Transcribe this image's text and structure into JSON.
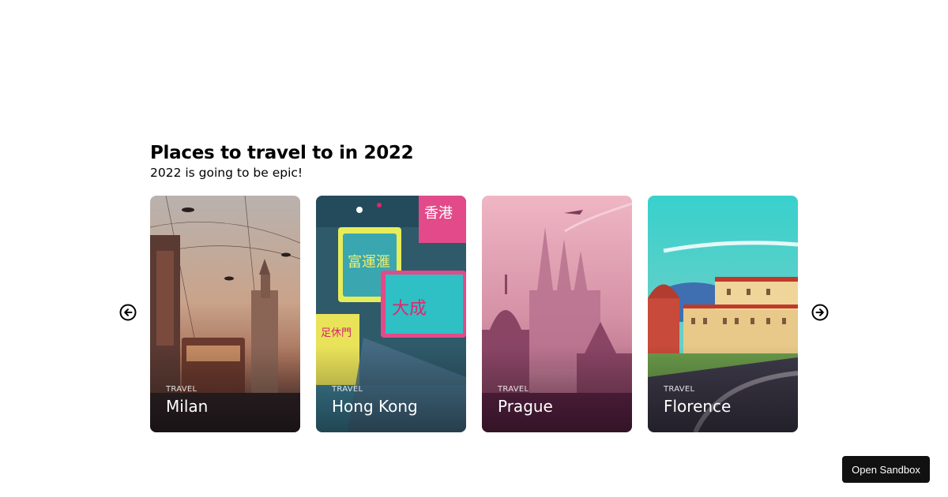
{
  "header": {
    "title": "Places to travel to in 2022",
    "subtitle": "2022 is going to be epic!"
  },
  "carousel": {
    "cards": [
      {
        "tag": "TRAVEL",
        "name": "Milan"
      },
      {
        "tag": "TRAVEL",
        "name": "Hong Kong"
      },
      {
        "tag": "TRAVEL",
        "name": "Prague"
      },
      {
        "tag": "TRAVEL",
        "name": "Florence"
      }
    ],
    "prev_icon": "arrow-left-circle-icon",
    "next_icon": "arrow-right-circle-icon"
  },
  "sandbox": {
    "label": "Open Sandbox"
  }
}
